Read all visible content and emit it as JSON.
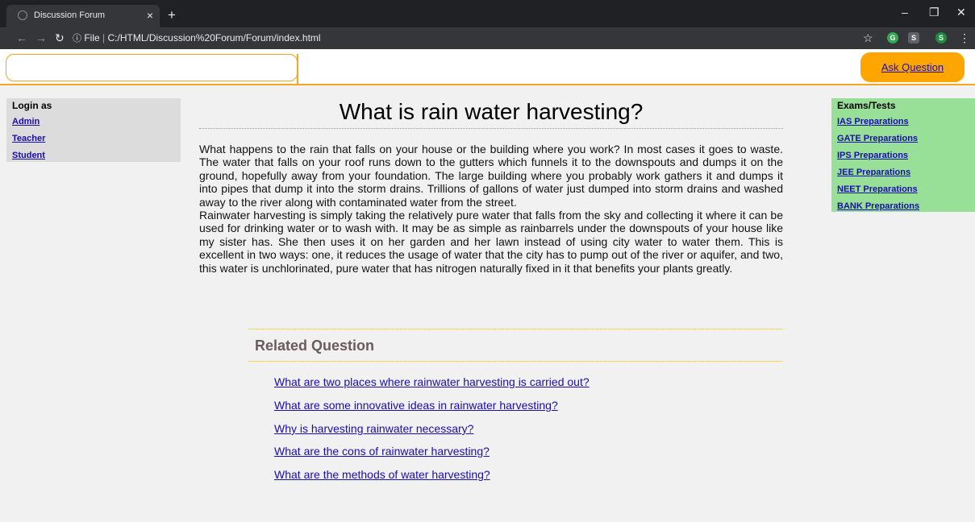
{
  "browser": {
    "tab_title": "Discussion Forum",
    "tab_close": "×",
    "new_tab": "+",
    "url_prefix": "File",
    "url_separator": "|",
    "url": "C:/HTML/Discussion%20Forum/Forum/index.html",
    "profile_letter": "S",
    "ext_g_letter": "G",
    "ext_s_letter": "S"
  },
  "header": {
    "search_value": "",
    "ask_question": "Ask Question"
  },
  "login": {
    "heading": "Login as",
    "items": [
      "Admin",
      "Teacher",
      "Student"
    ]
  },
  "exams": {
    "heading": "Exams/Tests",
    "items": [
      "IAS Preparations",
      "GATE Preparations",
      "IPS Preparations",
      "JEE Preparations",
      "NEET Preparations",
      "BANK Preparations"
    ]
  },
  "question": {
    "title": "What is rain water harvesting?",
    "paragraph1": "What happens to the rain that falls on your house or the building where you work? In most cases it goes to waste. The water that falls on your roof runs down to the gutters which funnels it to the downspouts and dumps it on the ground, hopefully away from your foundation. The large building where you probably work gathers it and dumps it into pipes that dump it into the storm drains. Trillions of gallons of water just dumped into storm drains and washed away to the river along with contaminated water from the street.",
    "paragraph2": "Rainwater harvesting is simply taking the relatively pure water that falls from the sky and collecting it where it can be used for drinking water or to wash with. It may be as simple as rainbarrels under the downspouts of your house like my sister has. She then uses it on her garden and her lawn instead of using city water to water them. This is excellent in two ways: one, it reduces the usage of water that the city has to pump out of the river or aquifer, and two, this water is unchlorinated, pure water that has nitrogen naturally fixed in it that benefits your plants greatly."
  },
  "related": {
    "heading": "Related Question",
    "items": [
      "What are two places where rainwater harvesting is carried out?",
      "What are some innovative ideas in rainwater harvesting?",
      "Why is harvesting rainwater necessary?",
      "What are the cons of rainwater harvesting?",
      "What are the methods of water harvesting?"
    ]
  },
  "colors": {
    "accent": "#ffa500",
    "link": "#1a0dab",
    "exams_bg": "#98e098",
    "login_bg": "#dcdcdc"
  }
}
